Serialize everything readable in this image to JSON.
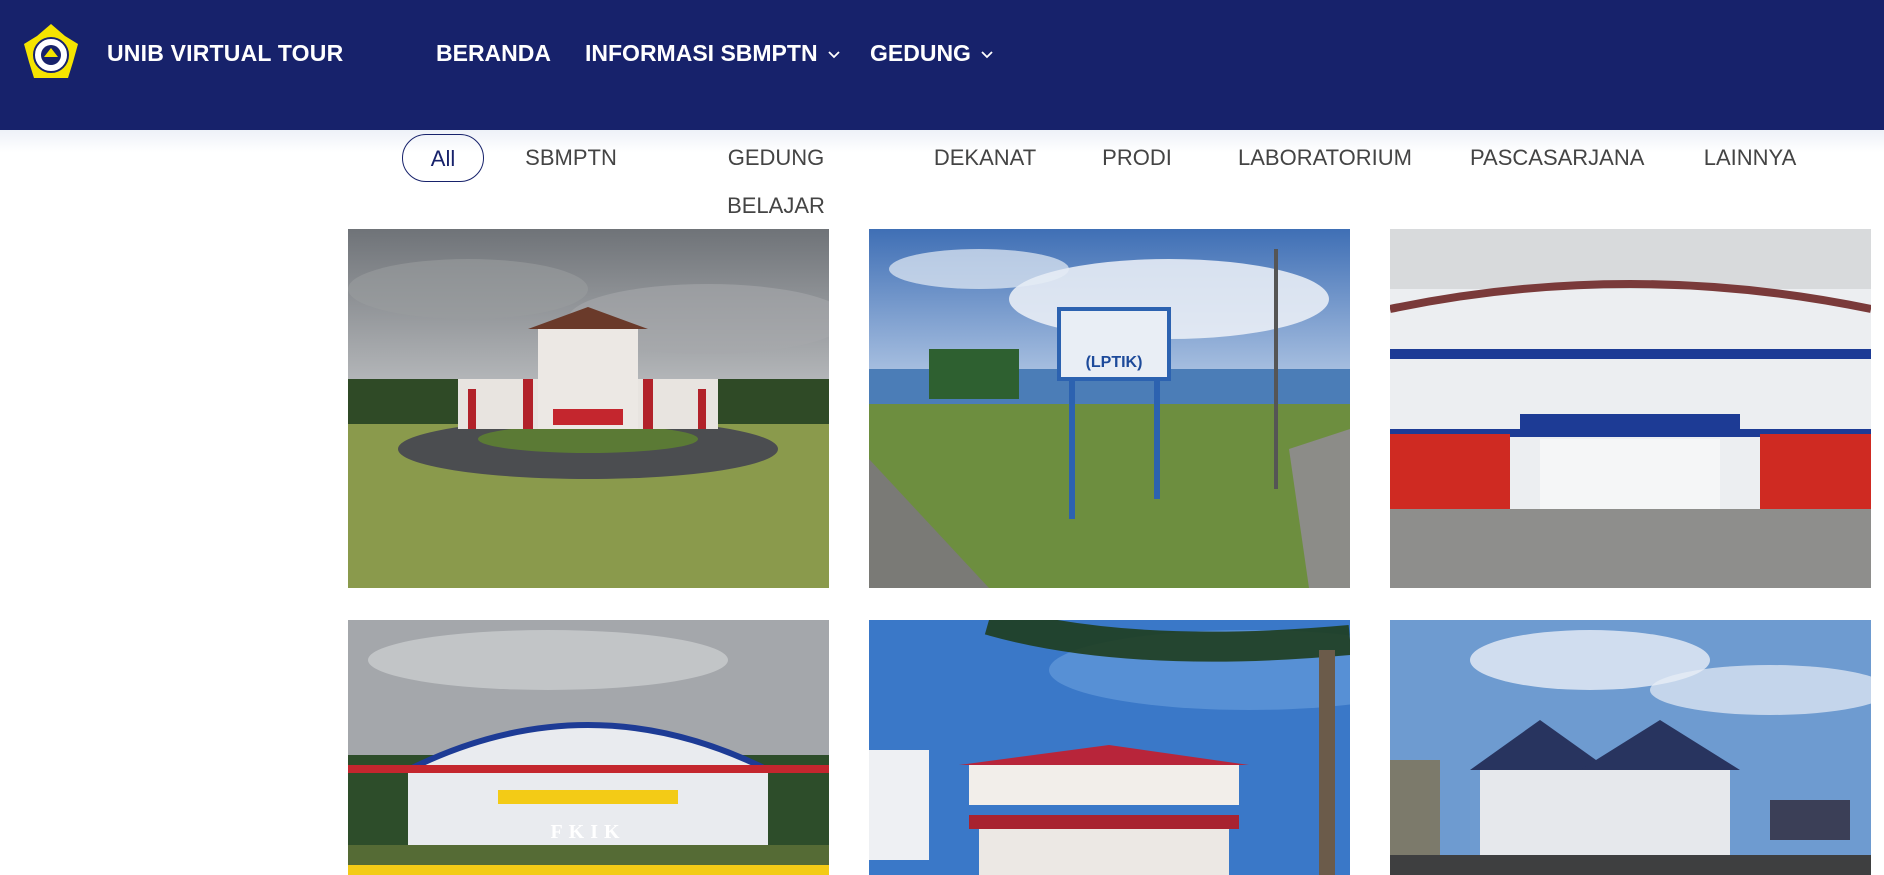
{
  "navbar": {
    "brand": "UNIB VIRTUAL TOUR",
    "logo_icon": "unib-logo-icon",
    "menu": [
      {
        "label": "BERANDA",
        "has_dropdown": false
      },
      {
        "label": "INFORMASI SBMPTN",
        "has_dropdown": true
      },
      {
        "label": "GEDUNG",
        "has_dropdown": true
      }
    ]
  },
  "filters": {
    "items": [
      "All",
      "SBMPTN",
      "GEDUNG BELAJAR",
      "DEKANAT",
      "PRODI",
      "LABORATORIUM",
      "PASCASARJANA",
      "LAINNYA"
    ],
    "active": "All"
  },
  "gallery": {
    "photos": [
      {
        "subject": "rectorate-building"
      },
      {
        "subject": "lptik-building",
        "sign_text": "(LPTIK)"
      },
      {
        "subject": "white-blue-building"
      },
      {
        "subject": "fkik-building",
        "sign_text": "FKIK"
      },
      {
        "subject": "red-roof-building"
      },
      {
        "subject": "blue-roof-building"
      }
    ]
  },
  "colors": {
    "navbar": "#17226b",
    "active_filter": "#17226b",
    "filter_text": "#444444"
  }
}
